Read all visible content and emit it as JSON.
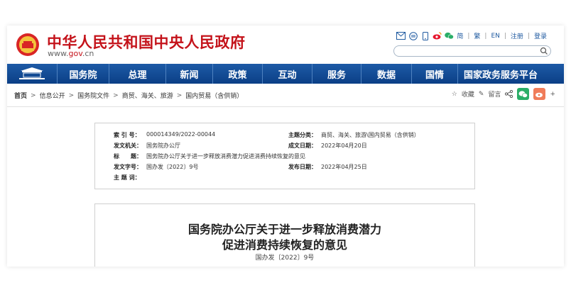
{
  "header": {
    "title": "中华人民共和国中央人民政府",
    "url_prefix": "www.",
    "url_main": "gov",
    "url_suffix": ".cn",
    "links": [
      "简",
      "繁",
      "EN",
      "注册",
      "登录"
    ],
    "icons": [
      "mail-icon",
      "tv-icon",
      "mobile-icon",
      "weibo-icon",
      "wechat-icon"
    ]
  },
  "nav": {
    "items": [
      "国务院",
      "总理",
      "新闻",
      "政策",
      "互动",
      "服务",
      "数据",
      "国情",
      "国家政务服务平台"
    ]
  },
  "breadcrumb": {
    "items": [
      "首页",
      "信息公开",
      "国务院文件",
      "商贸、海关、旅游",
      "国内贸易（含供销）"
    ]
  },
  "share": {
    "favorite": "收藏",
    "comment": "留言"
  },
  "info": {
    "index_label": "索 引 号：",
    "index_value": "000014349/2022-00044",
    "category_label": "主题分类：",
    "category_value": "商贸、海关、旅游\\国内贸易（含供销）",
    "issuer_label": "发文机关：",
    "issuer_value": "国务院办公厅",
    "date_label": "成文日期：",
    "date_value": "2022年04月20日",
    "subject_label": "标　　题：",
    "subject_value": "国务院办公厅关于进一步释放消费潜力促进消费持续恢复的意见",
    "docno_label": "发文字号：",
    "docno_value": "国办发〔2022〕9号",
    "pubdate_label": "发布日期：",
    "pubdate_value": "2022年04月25日",
    "keywords_label": "主 题 词：",
    "keywords_value": ""
  },
  "article": {
    "title_line1": "国务院办公厅关于进一步释放消费潜力",
    "title_line2": "促进消费持续恢复的意见",
    "doc_number": "国办发〔2022〕9号"
  },
  "colors": {
    "brand_red": "#c4121a",
    "nav_blue": "#1d5aa6",
    "link_blue": "#1f5aa0"
  }
}
